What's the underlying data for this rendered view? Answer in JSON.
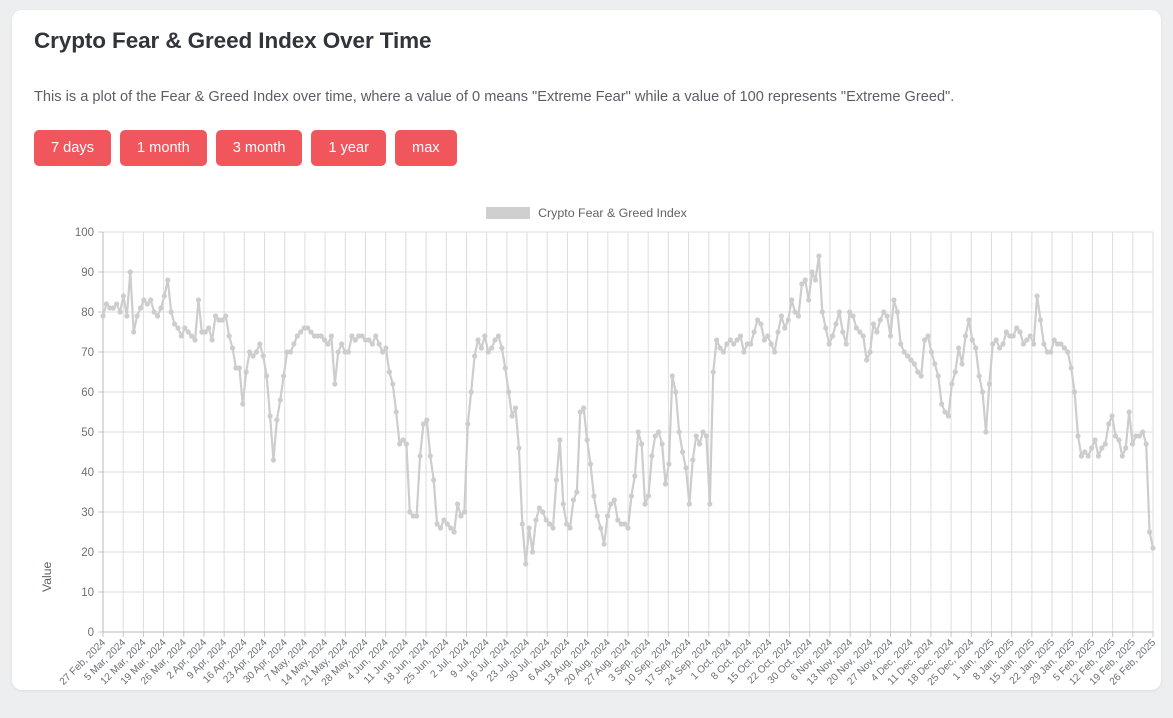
{
  "page": {
    "title": "Crypto Fear & Greed Index Over Time",
    "subtitle": "This is a plot of the Fear & Greed Index over time, where a value of 0 means \"Extreme Fear\" while a value of 100 represents \"Extreme Greed\".",
    "background_color": "#eceef0",
    "card_color": "#ffffff",
    "accent_color": "#f0565b"
  },
  "range_buttons": [
    {
      "label": "7 days",
      "name": "range-7-days"
    },
    {
      "label": "1 month",
      "name": "range-1-month"
    },
    {
      "label": "3 month",
      "name": "range-3-month"
    },
    {
      "label": "1 year",
      "name": "range-1-year"
    },
    {
      "label": "max",
      "name": "range-max"
    }
  ],
  "legend": {
    "label": "Crypto Fear & Greed Index",
    "swatch_color": "#cfcfcf"
  },
  "chart_data": {
    "type": "line",
    "title": "Crypto Fear & Greed Index Over Time",
    "xlabel": "",
    "ylabel": "Value",
    "ylim": [
      0,
      100
    ],
    "ytick_step": 10,
    "ytick_labels": [
      "0",
      "10",
      "20",
      "30",
      "40",
      "50",
      "60",
      "70",
      "80",
      "90",
      "100"
    ],
    "grid": true,
    "legend_position": "top-center",
    "line_color": "#cdcdcd",
    "marker": "circle",
    "series_name": "Crypto Fear & Greed Index",
    "x_start": "27 Feb, 2024",
    "x_end": "26 Feb, 2025",
    "xtick_labels": [
      "27 Feb, 2024",
      "5 Mar, 2024",
      "12 Mar, 2024",
      "19 Mar, 2024",
      "26 Mar, 2024",
      "2 Apr, 2024",
      "9 Apr, 2024",
      "16 Apr, 2024",
      "23 Apr, 2024",
      "30 Apr, 2024",
      "7 May, 2024",
      "14 May, 2024",
      "21 May, 2024",
      "28 May, 2024",
      "4 Jun, 2024",
      "11 Jun, 2024",
      "18 Jun, 2024",
      "25 Jun, 2024",
      "2 Jul, 2024",
      "9 Jul, 2024",
      "16 Jul, 2024",
      "23 Jul, 2024",
      "30 Jul, 2024",
      "6 Aug, 2024",
      "13 Aug, 2024",
      "20 Aug, 2024",
      "27 Aug, 2024",
      "3 Sep, 2024",
      "10 Sep, 2024",
      "17 Sep, 2024",
      "24 Sep, 2024",
      "1 Oct, 2024",
      "8 Oct, 2024",
      "15 Oct, 2024",
      "22 Oct, 2024",
      "30 Oct, 2024",
      "6 Nov, 2024",
      "13 Nov, 2024",
      "20 Nov, 2024",
      "27 Nov, 2024",
      "4 Dec, 2024",
      "11 Dec, 2024",
      "18 Dec, 2024",
      "25 Dec, 2024",
      "1 Jan, 2025",
      "8 Jan, 2025",
      "15 Jan, 2025",
      "22 Jan, 2025",
      "29 Jan, 2025",
      "5 Feb, 2025",
      "12 Feb, 2025",
      "19 Feb, 2025",
      "26 Feb, 2025"
    ],
    "values": [
      79,
      82,
      81,
      81,
      82,
      80,
      84,
      79,
      90,
      75,
      79,
      81,
      83,
      82,
      83,
      80,
      79,
      81,
      84,
      88,
      80,
      77,
      76,
      74,
      76,
      75,
      74,
      73,
      83,
      75,
      75,
      76,
      73,
      79,
      78,
      78,
      79,
      74,
      71,
      66,
      66,
      57,
      65,
      70,
      69,
      70,
      72,
      69,
      64,
      54,
      43,
      53,
      58,
      64,
      70,
      70,
      72,
      74,
      75,
      76,
      76,
      75,
      74,
      74,
      74,
      73,
      72,
      74,
      62,
      70,
      72,
      70,
      70,
      74,
      73,
      74,
      74,
      73,
      73,
      72,
      74,
      72,
      70,
      71,
      65,
      62,
      55,
      47,
      48,
      47,
      30,
      29,
      29,
      44,
      52,
      53,
      44,
      38,
      27,
      26,
      28,
      27,
      26,
      25,
      32,
      29,
      30,
      52,
      60,
      69,
      73,
      71,
      74,
      70,
      71,
      73,
      74,
      71,
      66,
      60,
      54,
      56,
      46,
      27,
      17,
      26,
      20,
      28,
      31,
      30,
      28,
      27,
      26,
      38,
      48,
      32,
      27,
      26,
      33,
      35,
      55,
      56,
      48,
      42,
      34,
      29,
      26,
      22,
      29,
      32,
      33,
      28,
      27,
      27,
      26,
      34,
      39,
      50,
      47,
      32,
      34,
      44,
      49,
      50,
      47,
      37,
      42,
      64,
      60,
      50,
      45,
      41,
      32,
      43,
      49,
      47,
      50,
      49,
      32,
      65,
      73,
      71,
      70,
      72,
      73,
      72,
      73,
      74,
      70,
      72,
      72,
      75,
      78,
      77,
      73,
      74,
      72,
      70,
      75,
      79,
      76,
      78,
      83,
      80,
      79,
      87,
      88,
      83,
      90,
      88,
      94,
      80,
      76,
      72,
      74,
      77,
      80,
      75,
      72,
      80,
      79,
      76,
      75,
      74,
      68,
      70,
      77,
      75,
      78,
      80,
      79,
      74,
      83,
      80,
      72,
      70,
      69,
      68,
      67,
      65,
      64,
      73,
      74,
      70,
      67,
      64,
      57,
      55,
      54,
      62,
      65,
      71,
      67,
      74,
      78,
      73,
      71,
      64,
      60,
      50,
      62,
      72,
      73,
      71,
      72,
      75,
      74,
      74,
      76,
      75,
      72,
      73,
      74,
      72,
      84,
      78,
      72,
      70,
      70,
      73,
      72,
      72,
      71,
      70,
      66,
      60,
      49,
      44,
      45,
      44,
      46,
      48,
      44,
      46,
      47,
      52,
      54,
      49,
      48,
      44,
      46,
      55,
      47,
      49,
      49,
      50,
      47,
      25,
      21
    ]
  }
}
